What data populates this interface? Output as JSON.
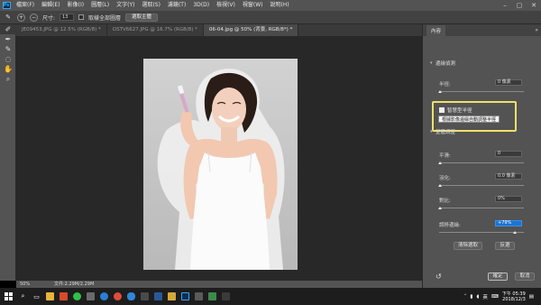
{
  "menubar": {
    "logo": "Ps",
    "items": [
      "檔案(F)",
      "編輯(E)",
      "影像(I)",
      "圖層(L)",
      "文字(Y)",
      "選取(S)",
      "濾鏡(T)",
      "3D(D)",
      "檢視(V)",
      "視窗(W)",
      "說明(H)"
    ]
  },
  "options": {
    "size_label": "尺寸:",
    "size_value": "13",
    "sample_all_layers": "取樣全部圖層",
    "select_subject": "選取主體"
  },
  "tabs": [
    "JE09453.JPG @ 12.5% (RGB/8) *",
    "OSTV6627.JPG @ 16.7% (RGB/8) *",
    "06-04.jpg @ 50% (背景, RGB/8*) *"
  ],
  "status": {
    "zoom": "50%",
    "doc": "文件:2.29M/2.29M"
  },
  "panel": {
    "tab": "內容",
    "edge_section": "邊緣偵測",
    "radius_label": "半徑:",
    "radius_value": "0 像素",
    "smart_radius": "智慧型半徑",
    "tooltip": "根據影像邊緣自動調整半徑",
    "global_section": "整體調整",
    "smooth_label": "平滑:",
    "smooth_value": "0",
    "feather_label": "羽化:",
    "feather_value": "0.0 像素",
    "contrast_label": "對比:",
    "contrast_value": "0%",
    "shift_label": "調移邊緣:",
    "shift_value": "+79%",
    "clear_btn": "清除選取",
    "invert_btn": "反選",
    "ok_btn": "確定",
    "cancel_btn": "取消"
  },
  "taskbar": {
    "ime": "英",
    "time": "下午 05:39",
    "date": "2018/12/3"
  }
}
